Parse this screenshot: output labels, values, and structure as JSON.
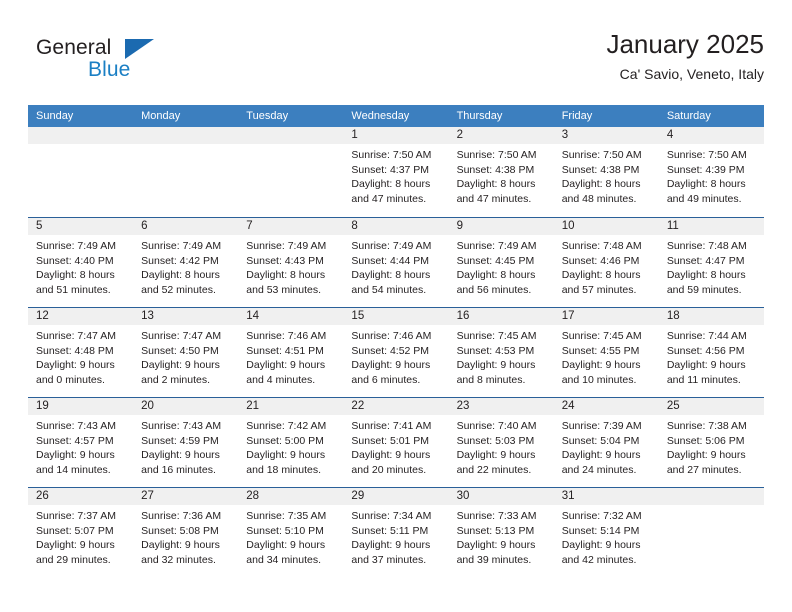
{
  "brand": {
    "word_one": "General",
    "word_two": "Blue",
    "triangle_icon": "triangle-icon",
    "accent_color": "#1b7fc4"
  },
  "header": {
    "title": "January 2025",
    "subtitle": "Ca' Savio, Veneto, Italy"
  },
  "calendar": {
    "header_bg": "#3c7fbf",
    "row_line_color": "#2a6099",
    "day_shade_color": "#f0f0f0",
    "weekdays": [
      "Sunday",
      "Monday",
      "Tuesday",
      "Wednesday",
      "Thursday",
      "Friday",
      "Saturday"
    ],
    "weeks": [
      [
        {
          "day": "",
          "lines": []
        },
        {
          "day": "",
          "lines": []
        },
        {
          "day": "",
          "lines": []
        },
        {
          "day": "1",
          "lines": [
            "Sunrise: 7:50 AM",
            "Sunset: 4:37 PM",
            "Daylight: 8 hours",
            "and 47 minutes."
          ]
        },
        {
          "day": "2",
          "lines": [
            "Sunrise: 7:50 AM",
            "Sunset: 4:38 PM",
            "Daylight: 8 hours",
            "and 47 minutes."
          ]
        },
        {
          "day": "3",
          "lines": [
            "Sunrise: 7:50 AM",
            "Sunset: 4:38 PM",
            "Daylight: 8 hours",
            "and 48 minutes."
          ]
        },
        {
          "day": "4",
          "lines": [
            "Sunrise: 7:50 AM",
            "Sunset: 4:39 PM",
            "Daylight: 8 hours",
            "and 49 minutes."
          ]
        }
      ],
      [
        {
          "day": "5",
          "lines": [
            "Sunrise: 7:49 AM",
            "Sunset: 4:40 PM",
            "Daylight: 8 hours",
            "and 51 minutes."
          ]
        },
        {
          "day": "6",
          "lines": [
            "Sunrise: 7:49 AM",
            "Sunset: 4:42 PM",
            "Daylight: 8 hours",
            "and 52 minutes."
          ]
        },
        {
          "day": "7",
          "lines": [
            "Sunrise: 7:49 AM",
            "Sunset: 4:43 PM",
            "Daylight: 8 hours",
            "and 53 minutes."
          ]
        },
        {
          "day": "8",
          "lines": [
            "Sunrise: 7:49 AM",
            "Sunset: 4:44 PM",
            "Daylight: 8 hours",
            "and 54 minutes."
          ]
        },
        {
          "day": "9",
          "lines": [
            "Sunrise: 7:49 AM",
            "Sunset: 4:45 PM",
            "Daylight: 8 hours",
            "and 56 minutes."
          ]
        },
        {
          "day": "10",
          "lines": [
            "Sunrise: 7:48 AM",
            "Sunset: 4:46 PM",
            "Daylight: 8 hours",
            "and 57 minutes."
          ]
        },
        {
          "day": "11",
          "lines": [
            "Sunrise: 7:48 AM",
            "Sunset: 4:47 PM",
            "Daylight: 8 hours",
            "and 59 minutes."
          ]
        }
      ],
      [
        {
          "day": "12",
          "lines": [
            "Sunrise: 7:47 AM",
            "Sunset: 4:48 PM",
            "Daylight: 9 hours",
            "and 0 minutes."
          ]
        },
        {
          "day": "13",
          "lines": [
            "Sunrise: 7:47 AM",
            "Sunset: 4:50 PM",
            "Daylight: 9 hours",
            "and 2 minutes."
          ]
        },
        {
          "day": "14",
          "lines": [
            "Sunrise: 7:46 AM",
            "Sunset: 4:51 PM",
            "Daylight: 9 hours",
            "and 4 minutes."
          ]
        },
        {
          "day": "15",
          "lines": [
            "Sunrise: 7:46 AM",
            "Sunset: 4:52 PM",
            "Daylight: 9 hours",
            "and 6 minutes."
          ]
        },
        {
          "day": "16",
          "lines": [
            "Sunrise: 7:45 AM",
            "Sunset: 4:53 PM",
            "Daylight: 9 hours",
            "and 8 minutes."
          ]
        },
        {
          "day": "17",
          "lines": [
            "Sunrise: 7:45 AM",
            "Sunset: 4:55 PM",
            "Daylight: 9 hours",
            "and 10 minutes."
          ]
        },
        {
          "day": "18",
          "lines": [
            "Sunrise: 7:44 AM",
            "Sunset: 4:56 PM",
            "Daylight: 9 hours",
            "and 11 minutes."
          ]
        }
      ],
      [
        {
          "day": "19",
          "lines": [
            "Sunrise: 7:43 AM",
            "Sunset: 4:57 PM",
            "Daylight: 9 hours",
            "and 14 minutes."
          ]
        },
        {
          "day": "20",
          "lines": [
            "Sunrise: 7:43 AM",
            "Sunset: 4:59 PM",
            "Daylight: 9 hours",
            "and 16 minutes."
          ]
        },
        {
          "day": "21",
          "lines": [
            "Sunrise: 7:42 AM",
            "Sunset: 5:00 PM",
            "Daylight: 9 hours",
            "and 18 minutes."
          ]
        },
        {
          "day": "22",
          "lines": [
            "Sunrise: 7:41 AM",
            "Sunset: 5:01 PM",
            "Daylight: 9 hours",
            "and 20 minutes."
          ]
        },
        {
          "day": "23",
          "lines": [
            "Sunrise: 7:40 AM",
            "Sunset: 5:03 PM",
            "Daylight: 9 hours",
            "and 22 minutes."
          ]
        },
        {
          "day": "24",
          "lines": [
            "Sunrise: 7:39 AM",
            "Sunset: 5:04 PM",
            "Daylight: 9 hours",
            "and 24 minutes."
          ]
        },
        {
          "day": "25",
          "lines": [
            "Sunrise: 7:38 AM",
            "Sunset: 5:06 PM",
            "Daylight: 9 hours",
            "and 27 minutes."
          ]
        }
      ],
      [
        {
          "day": "26",
          "lines": [
            "Sunrise: 7:37 AM",
            "Sunset: 5:07 PM",
            "Daylight: 9 hours",
            "and 29 minutes."
          ]
        },
        {
          "day": "27",
          "lines": [
            "Sunrise: 7:36 AM",
            "Sunset: 5:08 PM",
            "Daylight: 9 hours",
            "and 32 minutes."
          ]
        },
        {
          "day": "28",
          "lines": [
            "Sunrise: 7:35 AM",
            "Sunset: 5:10 PM",
            "Daylight: 9 hours",
            "and 34 minutes."
          ]
        },
        {
          "day": "29",
          "lines": [
            "Sunrise: 7:34 AM",
            "Sunset: 5:11 PM",
            "Daylight: 9 hours",
            "and 37 minutes."
          ]
        },
        {
          "day": "30",
          "lines": [
            "Sunrise: 7:33 AM",
            "Sunset: 5:13 PM",
            "Daylight: 9 hours",
            "and 39 minutes."
          ]
        },
        {
          "day": "31",
          "lines": [
            "Sunrise: 7:32 AM",
            "Sunset: 5:14 PM",
            "Daylight: 9 hours",
            "and 42 minutes."
          ]
        },
        {
          "day": "",
          "lines": []
        }
      ]
    ]
  }
}
